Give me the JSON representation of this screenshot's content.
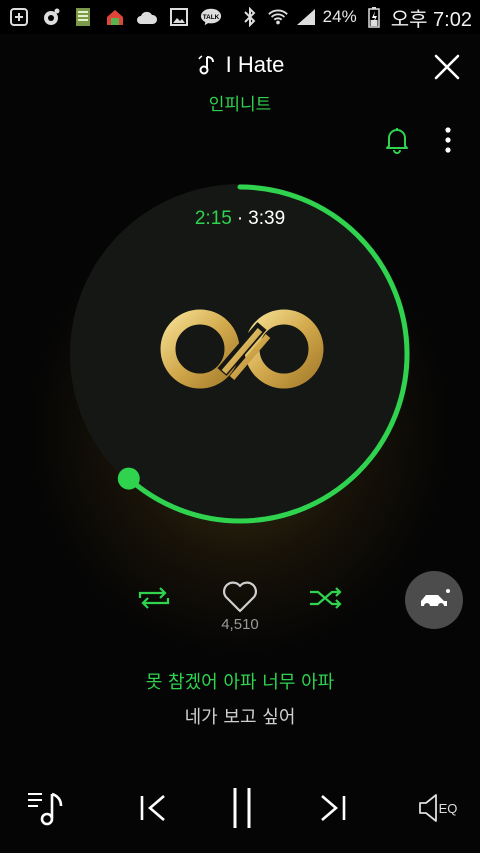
{
  "status_bar": {
    "battery": "24%",
    "time": "오후 7:02",
    "talk_icon_label": "TALK"
  },
  "player": {
    "song_title": "I Hate",
    "artist": "인피니트",
    "elapsed": "2:15",
    "total": "3:39",
    "progress_fraction": 0.616,
    "separator": "·",
    "like_count": "4,510"
  },
  "lyrics": {
    "current_line": "못 참겠어 아파 너무 아파",
    "next_line": "네가 보고 싶어"
  },
  "controls": {
    "eq_label": "EQ"
  },
  "colors": {
    "accent": "#2fd34e",
    "background": "#050505",
    "logo_gold": "#d8b45a"
  }
}
